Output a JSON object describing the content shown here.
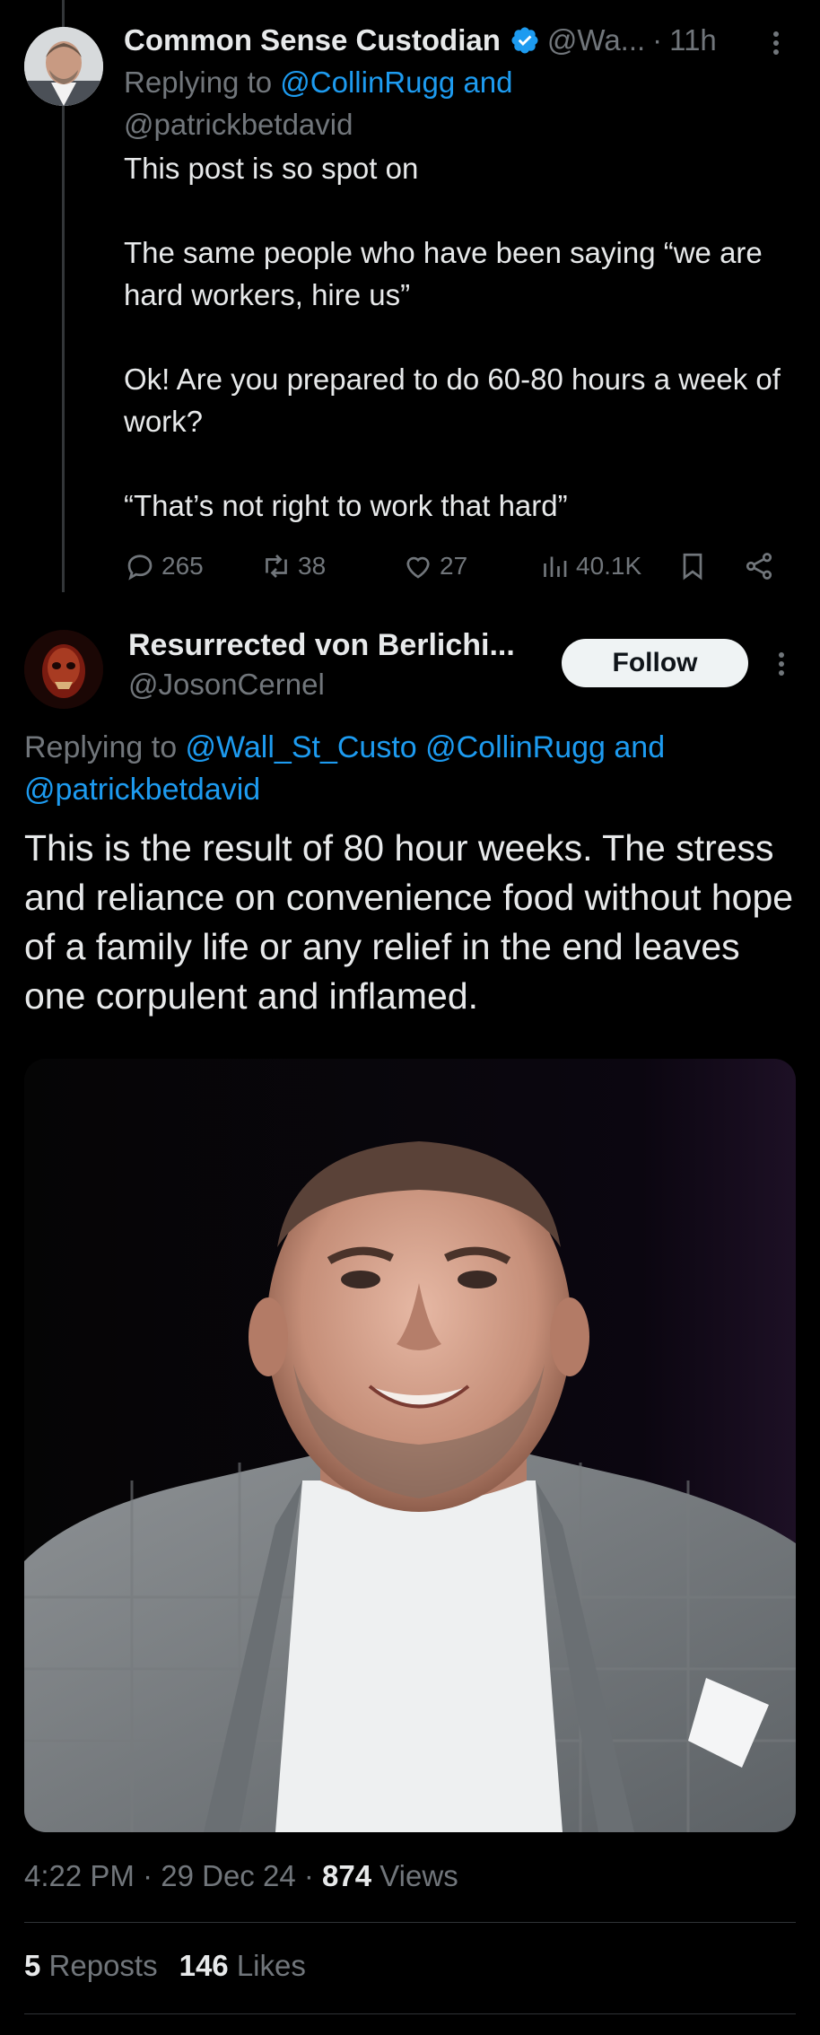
{
  "parent_tweet": {
    "display_name": "Common Sense Custodian",
    "handle": "@Wa...",
    "separator": "·",
    "time": "11h",
    "replying_prefix": "Replying to ",
    "replying_handles": "@CollinRugg and",
    "replying_handles_2": "@patrickbetdavid",
    "body": [
      "This post is so spot on",
      "The same people who have been saying “we are hard workers, hire us”",
      "Ok! Are you prepared to do 60-80 hours a week of work?",
      "“That’s not right to work that hard”"
    ],
    "actions": {
      "replies": "265",
      "reposts": "38",
      "likes": "27",
      "views": "40.1K"
    },
    "icons": [
      "reply-icon",
      "repost-icon",
      "like-icon",
      "views-icon",
      "bookmark-icon",
      "share-icon",
      "more-icon",
      "verified-badge-icon"
    ]
  },
  "main_tweet": {
    "display_name": "Resurrected von Berlichi...",
    "handle": "@JosonCernel",
    "follow_label": "Follow",
    "replying_prefix": "Replying to ",
    "replying_handles_1": "@Wall_St_Custo @CollinRugg and",
    "replying_handles_2": "@patrickbetdavid",
    "body": "This is the result of 80 hour weeks. The stress and reliance on convenience food without hope of a family life or any relief in the end leaves one corpulent and inflamed.",
    "time": "4:22 PM",
    "date": "29 Dec 24",
    "separator": "·",
    "views_count": "874",
    "views_label": "Views",
    "reposts_count": "5",
    "reposts_label": "Reposts",
    "likes_count": "146",
    "likes_label": "Likes"
  },
  "colors": {
    "background": "#000000",
    "text": "#e7e9ea",
    "muted": "#71767b",
    "link": "#1d9bf0",
    "follow_bg": "#eff3f4"
  }
}
